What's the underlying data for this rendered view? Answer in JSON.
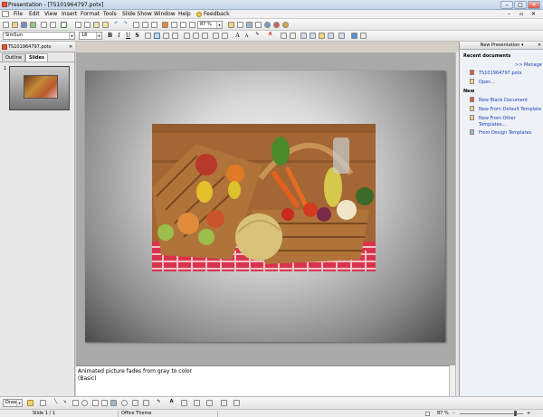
{
  "window": {
    "title": "Presentation - [TS101964797.potx]"
  },
  "menu": {
    "items": [
      {
        "label": "File"
      },
      {
        "label": "Edit"
      },
      {
        "label": "View"
      },
      {
        "label": "Insert"
      },
      {
        "label": "Format"
      },
      {
        "label": "Tools"
      },
      {
        "label": "Slide Show"
      },
      {
        "label": "Window"
      },
      {
        "label": "Help"
      },
      {
        "label": "Feedback"
      }
    ]
  },
  "toolbar": {
    "zoom_value": "87 %",
    "font_name": "SimSun",
    "font_size": "18",
    "bold": "B",
    "italic": "I",
    "underline": "U",
    "shadow": "S"
  },
  "document_tab": {
    "label": "TS101964797.potx"
  },
  "left_tabs": [
    {
      "label": "Outline"
    },
    {
      "label": "Slides"
    }
  ],
  "thumbnail": {
    "number": "1"
  },
  "slide": {
    "photo_colors": {
      "wood": "#a36634",
      "cloth": "#d9344c",
      "basket": "#b0743a"
    }
  },
  "notes": {
    "line1": "Animated picture fades from gray to color",
    "line2": "(Basic)"
  },
  "task_pane": {
    "title": "New Presentation",
    "recent_header": "Recent documents",
    "manage": ">> Manage",
    "recent_items": [
      {
        "label": "TS101964797.potx"
      },
      {
        "label": "Open..."
      }
    ],
    "new_header": "New",
    "new_items": [
      {
        "label": "New Blank Document"
      },
      {
        "label": "New From Default Template"
      },
      {
        "label": "New From Other"
      },
      {
        "label": "Templates..."
      },
      {
        "label": "From Design Templates"
      }
    ]
  },
  "drawing": {
    "label": "Draw"
  },
  "status": {
    "slide": "Slide 1 / 1",
    "theme": "Office Theme",
    "zoom": "87 %"
  }
}
